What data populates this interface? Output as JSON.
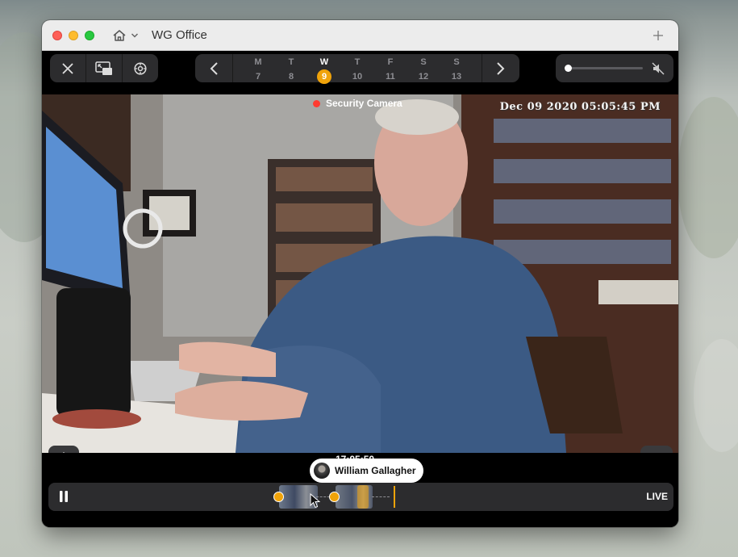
{
  "window": {
    "title": "WG Office"
  },
  "toolbar": {
    "close_icon": "close-icon",
    "pip_icon": "picture-in-picture-icon",
    "settings_icon": "settings-icon",
    "days": [
      {
        "letter": "M",
        "num": "7"
      },
      {
        "letter": "T",
        "num": "8"
      },
      {
        "letter": "W",
        "num": "9",
        "selected": true
      },
      {
        "letter": "T",
        "num": "10"
      },
      {
        "letter": "F",
        "num": "11"
      },
      {
        "letter": "S",
        "num": "12"
      },
      {
        "letter": "S",
        "num": "13"
      }
    ],
    "volume_level": 0.0,
    "muted": true
  },
  "video": {
    "camera_label": "Security Camera",
    "osd_timestamp": "Dec 09 2020  05:05:45 PM",
    "recording": true
  },
  "playback": {
    "current_time": "17:05:50",
    "tooltip_name": "William Gallagher",
    "live_label": "LIVE",
    "state": "playing"
  },
  "colors": {
    "accent": "#f0a30a",
    "record": "#ff3b30",
    "panel": "#2c2c2e"
  }
}
